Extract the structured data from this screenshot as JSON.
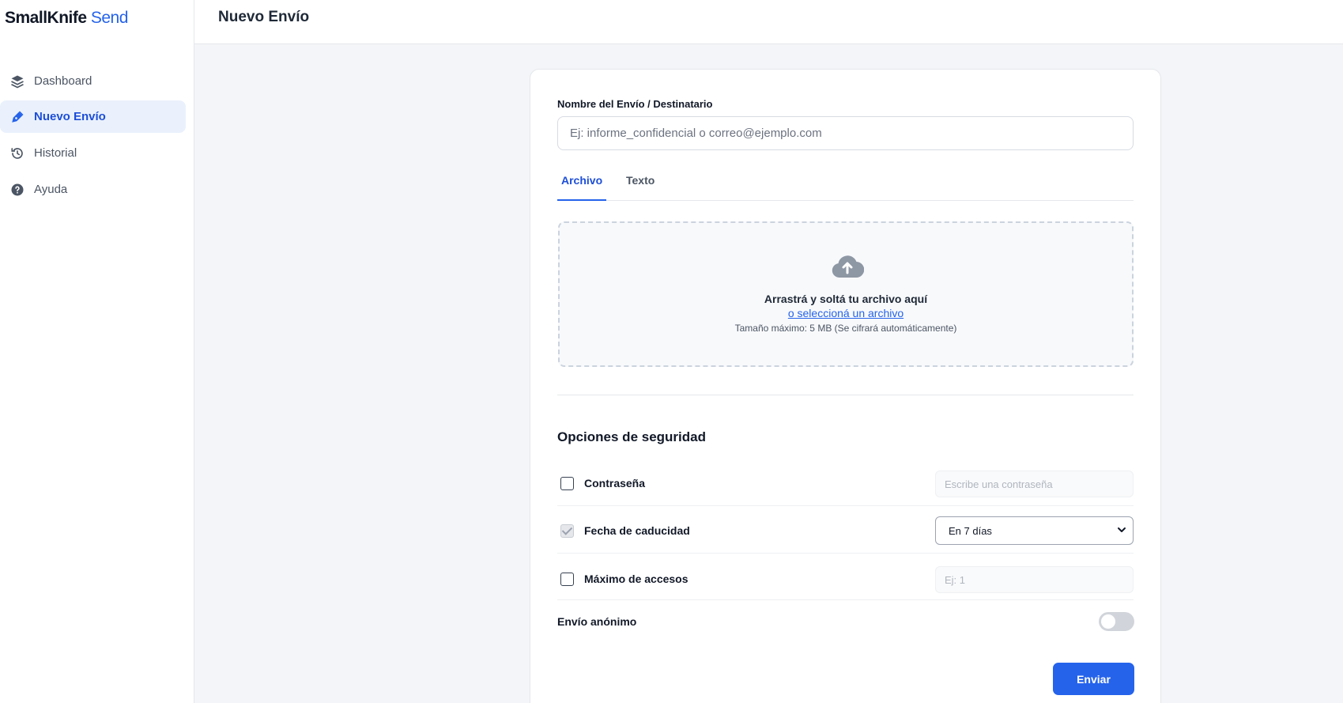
{
  "brand": {
    "name": "SmallKnife",
    "accent": "Send"
  },
  "sidebar": {
    "items": [
      {
        "label": "Dashboard",
        "icon": "layers-icon"
      },
      {
        "label": "Nuevo Envío",
        "icon": "pen-icon",
        "active": true
      },
      {
        "label": "Historial",
        "icon": "history-icon"
      },
      {
        "label": "Ayuda",
        "icon": "help-icon"
      }
    ]
  },
  "header": {
    "title": "Nuevo Envío"
  },
  "form": {
    "name_label": "Nombre del Envío / Destinatario",
    "name_placeholder": "Ej: informe_confidencial o correo@ejemplo.com",
    "tabs": [
      {
        "label": "Archivo",
        "active": true
      },
      {
        "label": "Texto",
        "active": false
      }
    ],
    "dropzone": {
      "icon": "cloud-upload-icon",
      "title": "Arrastrá y soltá tu archivo aquí",
      "link": "o seleccioná un archivo",
      "hint": "Tamaño máximo: 5 MB (Se cifrará automáticamente)"
    },
    "security": {
      "title": "Opciones de seguridad",
      "password": {
        "label": "Contraseña",
        "checked": false,
        "placeholder": "Escribe una contraseña"
      },
      "expiry": {
        "label": "Fecha de caducidad",
        "checked": true,
        "selected": "En 7 días"
      },
      "max_access": {
        "label": "Máximo de accesos",
        "checked": false,
        "placeholder": "Ej: 1"
      },
      "anonymous": {
        "label": "Envío anónimo",
        "enabled": false
      }
    },
    "submit_label": "Enviar"
  },
  "colors": {
    "accent": "#2563eb",
    "active_bg": "#eaf1fc"
  }
}
